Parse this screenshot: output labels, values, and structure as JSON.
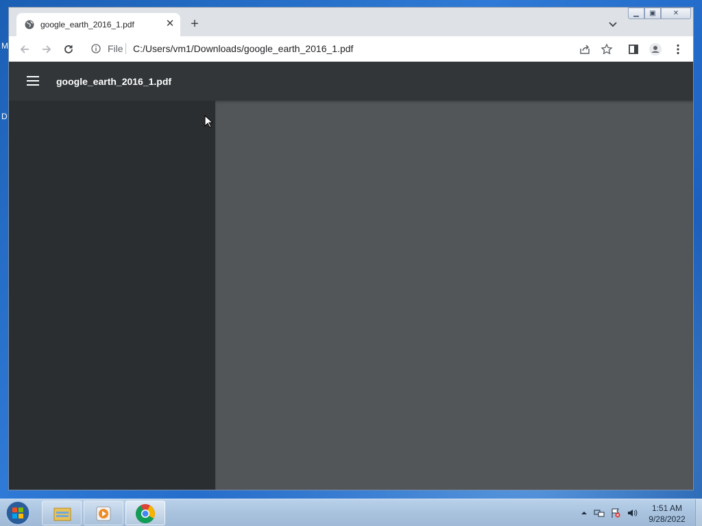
{
  "desktop": {
    "labels": [
      "M",
      "D"
    ]
  },
  "browser": {
    "tab": {
      "title": "google_earth_2016_1.pdf",
      "close_icon": "close-icon"
    },
    "new_tab_icon": "plus-icon",
    "toolbar": {
      "scheme": "File",
      "url": "C:/Users/vm1/Downloads/google_earth_2016_1.pdf"
    }
  },
  "pdf_viewer": {
    "title": "google_earth_2016_1.pdf",
    "header_color": "#323639",
    "sidebar_color": "#2b2e31",
    "content_color": "#525659"
  },
  "taskbar": {
    "clock": {
      "time": "1:51 AM",
      "date": "9/28/2022"
    },
    "apps": [
      "file-explorer",
      "media-player",
      "chrome"
    ]
  }
}
